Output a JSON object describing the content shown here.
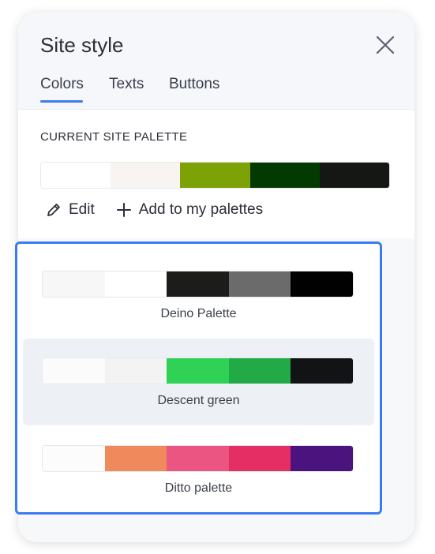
{
  "panel": {
    "title": "Site style",
    "close_icon": "close-icon"
  },
  "tabs": [
    {
      "label": "Colors",
      "active": true
    },
    {
      "label": "Texts",
      "active": false
    },
    {
      "label": "Buttons",
      "active": false
    }
  ],
  "current_palette": {
    "label": "CURRENT SITE PALETTE",
    "colors": [
      "#ffffff",
      "#f8f4f1",
      "#7ca205",
      "#023a02",
      "#141714"
    ],
    "edit_label": "Edit",
    "edit_icon": "pencil-icon",
    "add_label": "Add to my palettes",
    "add_icon": "plus-icon"
  },
  "palettes": [
    {
      "name": "Deino Palette",
      "colors": [
        "#f7f7f7",
        "#ffffff",
        "#1c1c1b",
        "#6b6b6b",
        "#010101"
      ],
      "selected": false
    },
    {
      "name": "Descent green",
      "colors": [
        "#fbfbfb",
        "#f3f3f3",
        "#2fd255",
        "#22aa46",
        "#121314"
      ],
      "selected": true
    },
    {
      "name": "Ditto palette",
      "colors": [
        "#fcfcfc",
        "#f08a5d",
        "#ea5581",
        "#e52e64",
        "#4b137e"
      ],
      "selected": false
    }
  ],
  "colors": {
    "accent": "#3b7bf0",
    "header_bg": "#f5f7fa",
    "selected_bg": "#edf0f5"
  }
}
